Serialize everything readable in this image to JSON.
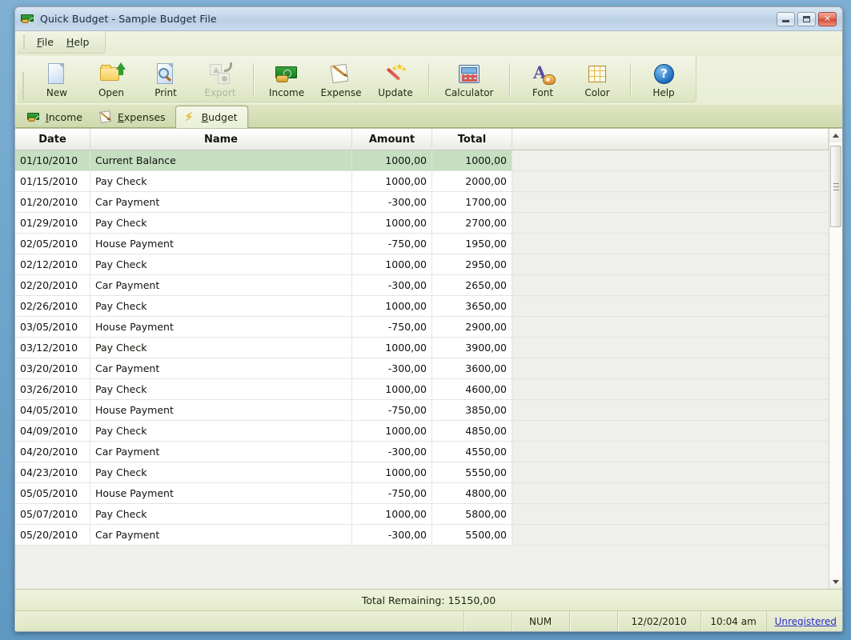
{
  "window": {
    "title": "Quick Budget - Sample Budget File",
    "icon": "money-icon",
    "controls": {
      "minimize": "–",
      "maximize": "□",
      "close": "✕"
    }
  },
  "menu": {
    "items": [
      {
        "name": "file",
        "accel": "F",
        "rest": "ile"
      },
      {
        "name": "help",
        "accel": "H",
        "rest": "elp"
      }
    ]
  },
  "toolbar": {
    "buttons": [
      {
        "label": "New",
        "icon": "new-page-icon",
        "disabled": false
      },
      {
        "label": "Open",
        "icon": "open-folder-icon",
        "disabled": false
      },
      {
        "label": "Print",
        "icon": "print-preview-icon",
        "disabled": false
      },
      {
        "label": "Export",
        "icon": "export-icon",
        "disabled": true
      },
      {
        "label": "Income",
        "icon": "income-money-icon",
        "disabled": false
      },
      {
        "label": "Expense",
        "icon": "expense-note-icon",
        "disabled": false
      },
      {
        "label": "Update",
        "icon": "update-wand-icon",
        "disabled": false
      },
      {
        "label": "Calculator",
        "icon": "calculator-icon",
        "disabled": false
      },
      {
        "label": "Font",
        "icon": "font-icon",
        "disabled": false
      },
      {
        "label": "Color",
        "icon": "color-grid-icon",
        "disabled": false
      },
      {
        "label": "Help",
        "icon": "help-question-icon",
        "disabled": false
      }
    ]
  },
  "tabs": [
    {
      "name": "income",
      "accel": "I",
      "rest": "ncome",
      "icon": "money-icon",
      "active": false
    },
    {
      "name": "expenses",
      "accel": "E",
      "rest": "xpenses",
      "icon": "note-pen-icon",
      "active": false
    },
    {
      "name": "budget",
      "accel": "B",
      "rest": "udget",
      "icon": "lightning-bolt-icon",
      "active": true
    }
  ],
  "grid": {
    "columns": [
      "Date",
      "Name",
      "Amount",
      "Total"
    ],
    "rows": [
      {
        "date": "01/10/2010",
        "name": "Current Balance",
        "amount": "1000,00",
        "total": "1000,00",
        "selected": true
      },
      {
        "date": "01/15/2010",
        "name": "Pay Check",
        "amount": "1000,00",
        "total": "2000,00",
        "selected": false
      },
      {
        "date": "01/20/2010",
        "name": "Car Payment",
        "amount": "-300,00",
        "total": "1700,00",
        "selected": false
      },
      {
        "date": "01/29/2010",
        "name": "Pay Check",
        "amount": "1000,00",
        "total": "2700,00",
        "selected": false
      },
      {
        "date": "02/05/2010",
        "name": "House Payment",
        "amount": "-750,00",
        "total": "1950,00",
        "selected": false
      },
      {
        "date": "02/12/2010",
        "name": "Pay Check",
        "amount": "1000,00",
        "total": "2950,00",
        "selected": false
      },
      {
        "date": "02/20/2010",
        "name": "Car Payment",
        "amount": "-300,00",
        "total": "2650,00",
        "selected": false
      },
      {
        "date": "02/26/2010",
        "name": "Pay Check",
        "amount": "1000,00",
        "total": "3650,00",
        "selected": false
      },
      {
        "date": "03/05/2010",
        "name": "House Payment",
        "amount": "-750,00",
        "total": "2900,00",
        "selected": false
      },
      {
        "date": "03/12/2010",
        "name": "Pay Check",
        "amount": "1000,00",
        "total": "3900,00",
        "selected": false
      },
      {
        "date": "03/20/2010",
        "name": "Car Payment",
        "amount": "-300,00",
        "total": "3600,00",
        "selected": false
      },
      {
        "date": "03/26/2010",
        "name": "Pay Check",
        "amount": "1000,00",
        "total": "4600,00",
        "selected": false
      },
      {
        "date": "04/05/2010",
        "name": "House Payment",
        "amount": "-750,00",
        "total": "3850,00",
        "selected": false
      },
      {
        "date": "04/09/2010",
        "name": "Pay Check",
        "amount": "1000,00",
        "total": "4850,00",
        "selected": false
      },
      {
        "date": "04/20/2010",
        "name": "Car Payment",
        "amount": "-300,00",
        "total": "4550,00",
        "selected": false
      },
      {
        "date": "04/23/2010",
        "name": "Pay Check",
        "amount": "1000,00",
        "total": "5550,00",
        "selected": false
      },
      {
        "date": "05/05/2010",
        "name": "House Payment",
        "amount": "-750,00",
        "total": "4800,00",
        "selected": false
      },
      {
        "date": "05/07/2010",
        "name": "Pay Check",
        "amount": "1000,00",
        "total": "5800,00",
        "selected": false
      },
      {
        "date": "05/20/2010",
        "name": "Car Payment",
        "amount": "-300,00",
        "total": "5500,00",
        "selected": false
      }
    ]
  },
  "total_bar": {
    "text": "Total Remaining: 15150,00"
  },
  "statusbar": {
    "num": "NUM",
    "date": "12/02/2010",
    "time": "10:04 am",
    "registration": "Unregistered"
  },
  "colors": {
    "selection_green": "#c5dfc0",
    "toolbar_green": "#e9eed6",
    "tab_strip": "#d5ddb5",
    "title_blue": "#c6d9ec",
    "link_blue": "#2a2ad0",
    "close_red": "#d8452c"
  }
}
